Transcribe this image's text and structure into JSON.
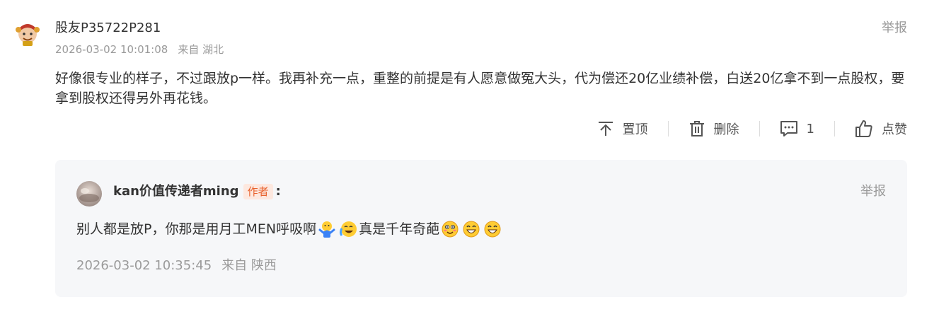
{
  "comment": {
    "username": "股友P35722P281",
    "datetime": "2026-03-02 10:01:08",
    "location": "来自 湖北",
    "report_label": "举报",
    "text": "好像很专业的样子，不过跟放p一样。我再补充一点，重整的前提是有人愿意做冤大头，代为偿还20亿业绩补偿，白送20亿拿不到一点股权，要拿到股权还得另外再花钱。",
    "actions": {
      "pin_label": "置顶",
      "delete_label": "删除",
      "reply_count": "1",
      "like_label": "点赞"
    }
  },
  "reply": {
    "username": "kan价值传递者ming",
    "author_badge": "作者",
    "colon": ":",
    "report_label": "举报",
    "text_part1": "别人都是放P，你那是用月工MEN呼吸啊",
    "text_part2": "真是千年奇葩",
    "datetime": "2026-03-02 10:35:45",
    "location": "来自 陕西",
    "emojis": [
      "shrug-emoji",
      "crying-laughing-emoji",
      "smiling-blush-emoji",
      "grinning-emoji",
      "grinning-emoji"
    ]
  },
  "colors": {
    "badge_text": "#e8612c",
    "badge_bg": "#fde8df",
    "reply_bg": "#f6f7f9",
    "muted": "#9a9a9a"
  }
}
